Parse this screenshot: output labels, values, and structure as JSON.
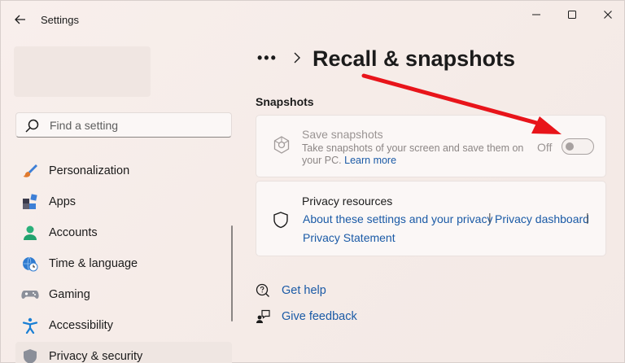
{
  "window": {
    "title": "Settings"
  },
  "search": {
    "placeholder": "Find a setting"
  },
  "sidebar": {
    "items": [
      {
        "label": "Personalization",
        "icon": "brush-icon"
      },
      {
        "label": "Apps",
        "icon": "apps-icon"
      },
      {
        "label": "Accounts",
        "icon": "person-icon"
      },
      {
        "label": "Time & language",
        "icon": "globe-clock-icon"
      },
      {
        "label": "Gaming",
        "icon": "gamepad-icon"
      },
      {
        "label": "Accessibility",
        "icon": "accessibility-icon"
      },
      {
        "label": "Privacy & security",
        "icon": "shield-icon",
        "selected": true
      }
    ]
  },
  "breadcrumb": {
    "overflow": "•••",
    "current": "Recall & snapshots"
  },
  "snapshots": {
    "section_title": "Snapshots",
    "save_title": "Save snapshots",
    "save_desc": "Take snapshots of your screen and save them on your PC.",
    "learn_more": "Learn more",
    "toggle_state": "Off",
    "toggle_on": false
  },
  "privacy": {
    "title": "Privacy resources",
    "link_about": "About these settings and your privacy",
    "link_dashboard": "Privacy dashboard",
    "link_statement": "Privacy Statement",
    "separator": "|"
  },
  "footer": {
    "help": "Get help",
    "feedback": "Give feedback"
  },
  "colors": {
    "accent_link": "#1a5aa6",
    "annotation_arrow": "#e8141a",
    "background": "#f6ece8"
  }
}
